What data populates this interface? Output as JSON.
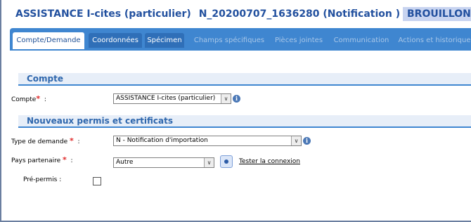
{
  "header": {
    "title_parts": [
      "ASSISTANCE I-cites (particulier)",
      "N_20200707_1636280 (Notification )"
    ],
    "status_badge": "BROUILLON"
  },
  "tabs": [
    {
      "label": "Compte/Demande",
      "state": "active"
    },
    {
      "label": "Coordonnées",
      "state": "normal"
    },
    {
      "label": "Spécimen",
      "state": "normal"
    },
    {
      "label": "Champs spécifiques",
      "state": "disabled"
    },
    {
      "label": "Pièces jointes",
      "state": "disabled"
    },
    {
      "label": "Communication",
      "state": "disabled"
    },
    {
      "label": "Actions et historique",
      "state": "disabled"
    }
  ],
  "sections": {
    "compte": {
      "title": "Compte",
      "label": "Compte",
      "required_mark": "*",
      "separator": ":",
      "value": "ASSISTANCE I-cites (particulier)"
    },
    "nouveaux": {
      "title": "Nouveaux permis et certificats",
      "type_demande": {
        "label": "Type de demande",
        "required_mark": "*",
        "separator": ":",
        "value": "N - Notification d'importation"
      },
      "pays": {
        "label": "Pays partenaire",
        "required_mark": "*",
        "separator": ":",
        "value": "Autre",
        "link": "Tester la connexion"
      },
      "prepermis": {
        "label": "Pré-permis",
        "separator": ":",
        "checked": false
      }
    }
  },
  "icons": {
    "info": "info-icon",
    "dropdown": "chevron-down-icon",
    "eye": "eye-icon"
  },
  "colors": {
    "accent": "#3f86d0",
    "title": "#23519f",
    "required": "#e02a2a"
  }
}
